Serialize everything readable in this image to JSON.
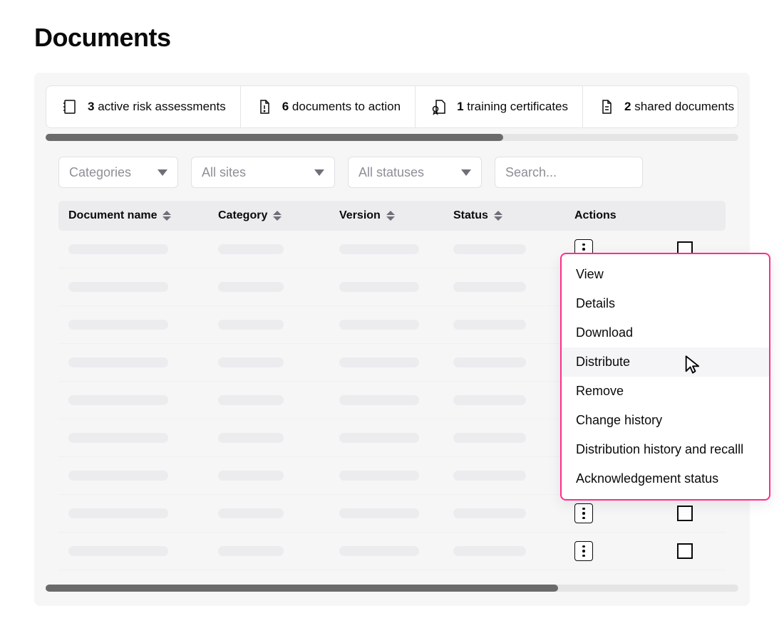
{
  "page": {
    "title": "Documents"
  },
  "stats": [
    {
      "count": "3",
      "label": "active risk assessments"
    },
    {
      "count": "6",
      "label": "documents to action"
    },
    {
      "count": "1",
      "label": "training certificates"
    },
    {
      "count": "2",
      "label": "shared documents"
    }
  ],
  "filters": {
    "categories": "Categories",
    "sites": "All sites",
    "statuses": "All statuses"
  },
  "search": {
    "placeholder": "Search..."
  },
  "columns": {
    "doc_name": "Document name",
    "category": "Category",
    "version": "Version",
    "status": "Status",
    "actions": "Actions"
  },
  "row_count": 9,
  "menu": {
    "items": [
      "View",
      "Details",
      "Download",
      "Distribute",
      "Remove",
      "Change history",
      "Distribution history and recalll",
      "Acknowledgement status"
    ],
    "hovered_index": 3
  }
}
